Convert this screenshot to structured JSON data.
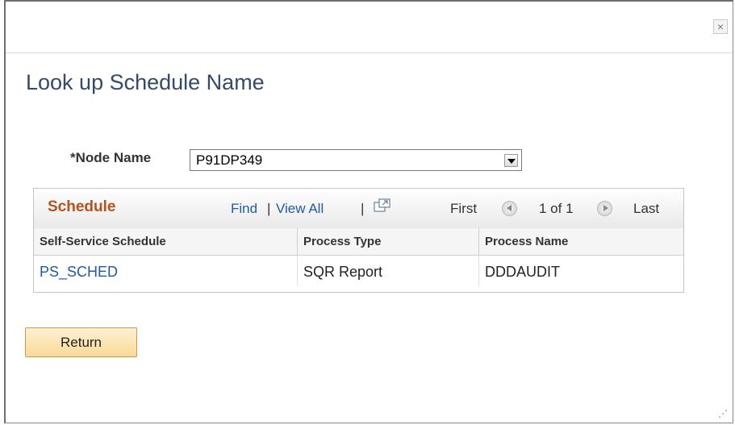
{
  "dialog": {
    "close_glyph": "×",
    "title": "Look up Schedule Name"
  },
  "node": {
    "label": "*Node Name",
    "value": "P91DP349"
  },
  "grid": {
    "title": "Schedule",
    "find": "Find",
    "sep1": "|",
    "view_all": "View All",
    "sep2": "|",
    "first": "First",
    "range": "1 of 1",
    "last": "Last",
    "columns": [
      "Self-Service Schedule",
      "Process Type",
      "Process Name"
    ],
    "rows": [
      [
        "PS_SCHED",
        "SQR Report",
        "DDDAUDIT"
      ]
    ]
  },
  "buttons": {
    "return_label": "Return"
  },
  "colors": {
    "title": "#354a6a",
    "grid_title": "#b3541e",
    "link": "#1f5aa8",
    "button": "#f9d996"
  },
  "icons": {
    "close": "close-icon",
    "popup": "new-window-icon",
    "prev": "previous-arrow-icon",
    "next": "next-arrow-icon",
    "dropdown": "chevron-down-icon"
  }
}
